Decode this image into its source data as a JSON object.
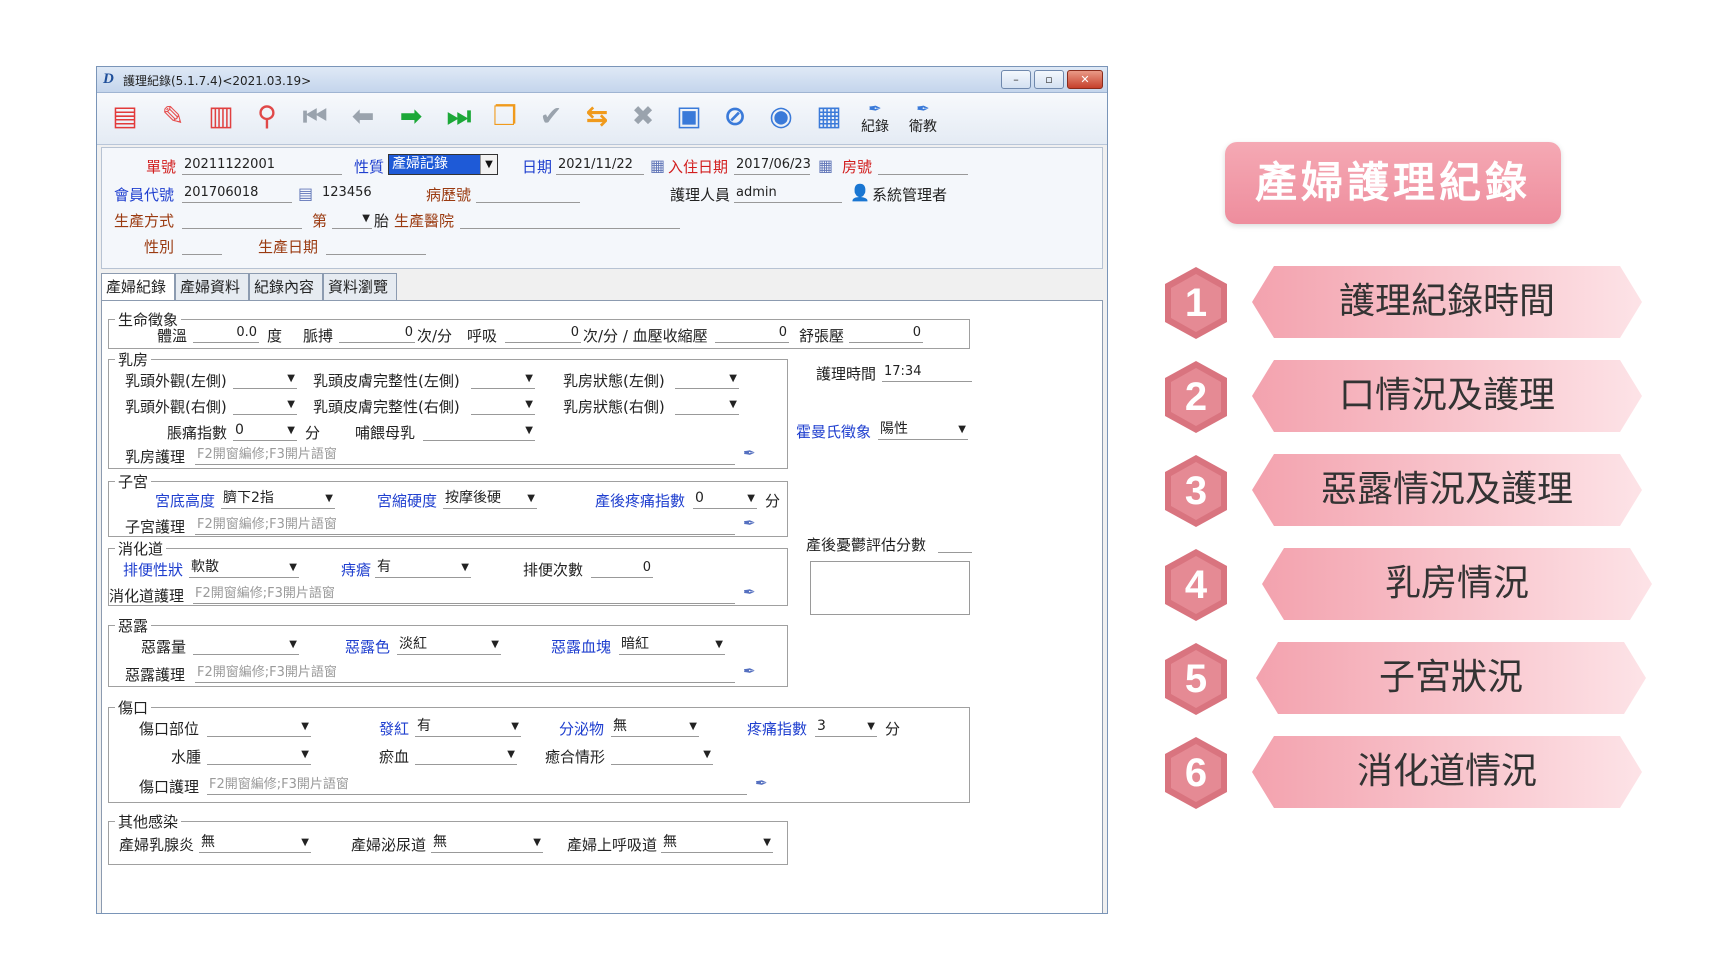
{
  "window": {
    "title": "護理紀錄(5.1.7.4)<2021.03.19>",
    "minimize": "–",
    "restore": "▫",
    "close": "✕"
  },
  "toolbar": {
    "record_label": "紀錄",
    "education_label": "衛教"
  },
  "header": {
    "order_no_label": "單號",
    "order_no": "20211122001",
    "nature_label": "性質",
    "nature_value": "產婦記錄",
    "date_label": "日期",
    "date_value": "2021/11/22",
    "admit_date_label": "入住日期",
    "admit_date_value": "2017/06/23",
    "room_label": "房號",
    "member_label": "會員代號",
    "member_value": "201706018",
    "card_value": "123456",
    "chart_label": "病歷號",
    "nurse_label": "護理人員",
    "nurse_value": "admin",
    "admin_label": "系統管理者",
    "delivery_method_label": "生產方式",
    "parity_label": "第",
    "fetus_label": "胎",
    "hospital_label": "生產醫院",
    "sex_label": "性別",
    "birth_date_label": "生產日期"
  },
  "tabs": [
    "產婦紀錄",
    "產婦資料",
    "紀錄內容",
    "資料瀏覽"
  ],
  "vitals": {
    "group": "生命徵象",
    "temp_label": "體溫",
    "temp_value": "0.0",
    "temp_unit": "度",
    "pulse_label": "脈搏",
    "pulse_value": "0",
    "pulse_unit": "次/分",
    "resp_label": "呼吸",
    "resp_value": "0",
    "resp_unit": "次/分 / 血壓收縮壓",
    "systolic_value": "0",
    "diastolic_label": "舒張壓",
    "diastolic_value": "0"
  },
  "breast": {
    "group": "乳房",
    "nipple_left": "乳頭外觀(左側)",
    "nipple_right": "乳頭外觀(右側)",
    "skin_left": "乳頭皮膚完整性(左側)",
    "skin_right": "乳頭皮膚完整性(右側)",
    "state_left": "乳房狀態(左側)",
    "state_right": "乳房狀態(右側)",
    "pain_label": "脹痛指數",
    "pain_value": "0",
    "pain_unit": "分",
    "feed_label": "哺餵母乳",
    "care_label": "乳房護理",
    "care_hint": "F2開窗編修;F3開片語窗"
  },
  "side": {
    "time_label": "護理時間",
    "time_value": "17:34",
    "homans_label": "霍曼氏徵象",
    "homans_value": "陽性",
    "depress_label": "產後憂鬱評估分數"
  },
  "uterus": {
    "group": "子宮",
    "fundus_label": "宮底高度",
    "fundus_value": "臍下2指",
    "firm_label": "宮縮硬度",
    "firm_value": "按摩後硬",
    "pain_label": "產後疼痛指數",
    "pain_value": "0",
    "pain_unit": "分",
    "care_label": "子宮護理",
    "care_hint": "F2開窗編修;F3開片語窗"
  },
  "digest": {
    "group": "消化道",
    "stool_label": "排便性狀",
    "stool_value": "軟散",
    "hemo_label": "痔瘡",
    "hemo_value": "有",
    "count_label": "排便次數",
    "count_value": "0",
    "care_label": "消化道護理",
    "care_hint": "F2開窗編修;F3開片語窗"
  },
  "lochia": {
    "group": "惡露",
    "amount_label": "惡露量",
    "color_label": "惡露色",
    "color_value": "淡紅",
    "clot_label": "惡露血塊",
    "clot_value": "暗紅",
    "care_label": "惡露護理",
    "care_hint": "F2開窗編修;F3開片語窗"
  },
  "wound": {
    "group": "傷口",
    "site_label": "傷口部位",
    "red_label": "發紅",
    "red_value": "有",
    "secr_label": "分泌物",
    "secr_value": "無",
    "pain_label": "疼痛指數",
    "pain_value": "3",
    "pain_unit": "分",
    "edema_label": "水腫",
    "ecchy_label": "瘀血",
    "heal_label": "癒合情形",
    "care_label": "傷口護理",
    "care_hint": "F2開窗編修;F3開片語窗"
  },
  "infect": {
    "group": "其他感染",
    "mastitis_label": "產婦乳腺炎",
    "mastitis_value": "無",
    "uti_label": "產婦泌尿道",
    "uti_value": "無",
    "uri_label": "產婦上呼吸道",
    "uri_value": "無"
  },
  "panel": {
    "banner": "產婦護理紀錄",
    "items": [
      {
        "num": "1",
        "text": "護理紀錄時間"
      },
      {
        "num": "2",
        "text": "口情況及護理"
      },
      {
        "num": "3",
        "text": "惡露情況及護理"
      },
      {
        "num": "4",
        "text": "乳房情況"
      },
      {
        "num": "5",
        "text": "子宮狀況"
      },
      {
        "num": "6",
        "text": "消化道情況"
      }
    ],
    "colors": {
      "banner": "#ef909f",
      "hex": "#d9747f",
      "ribbon": "#f7b7c1"
    }
  }
}
